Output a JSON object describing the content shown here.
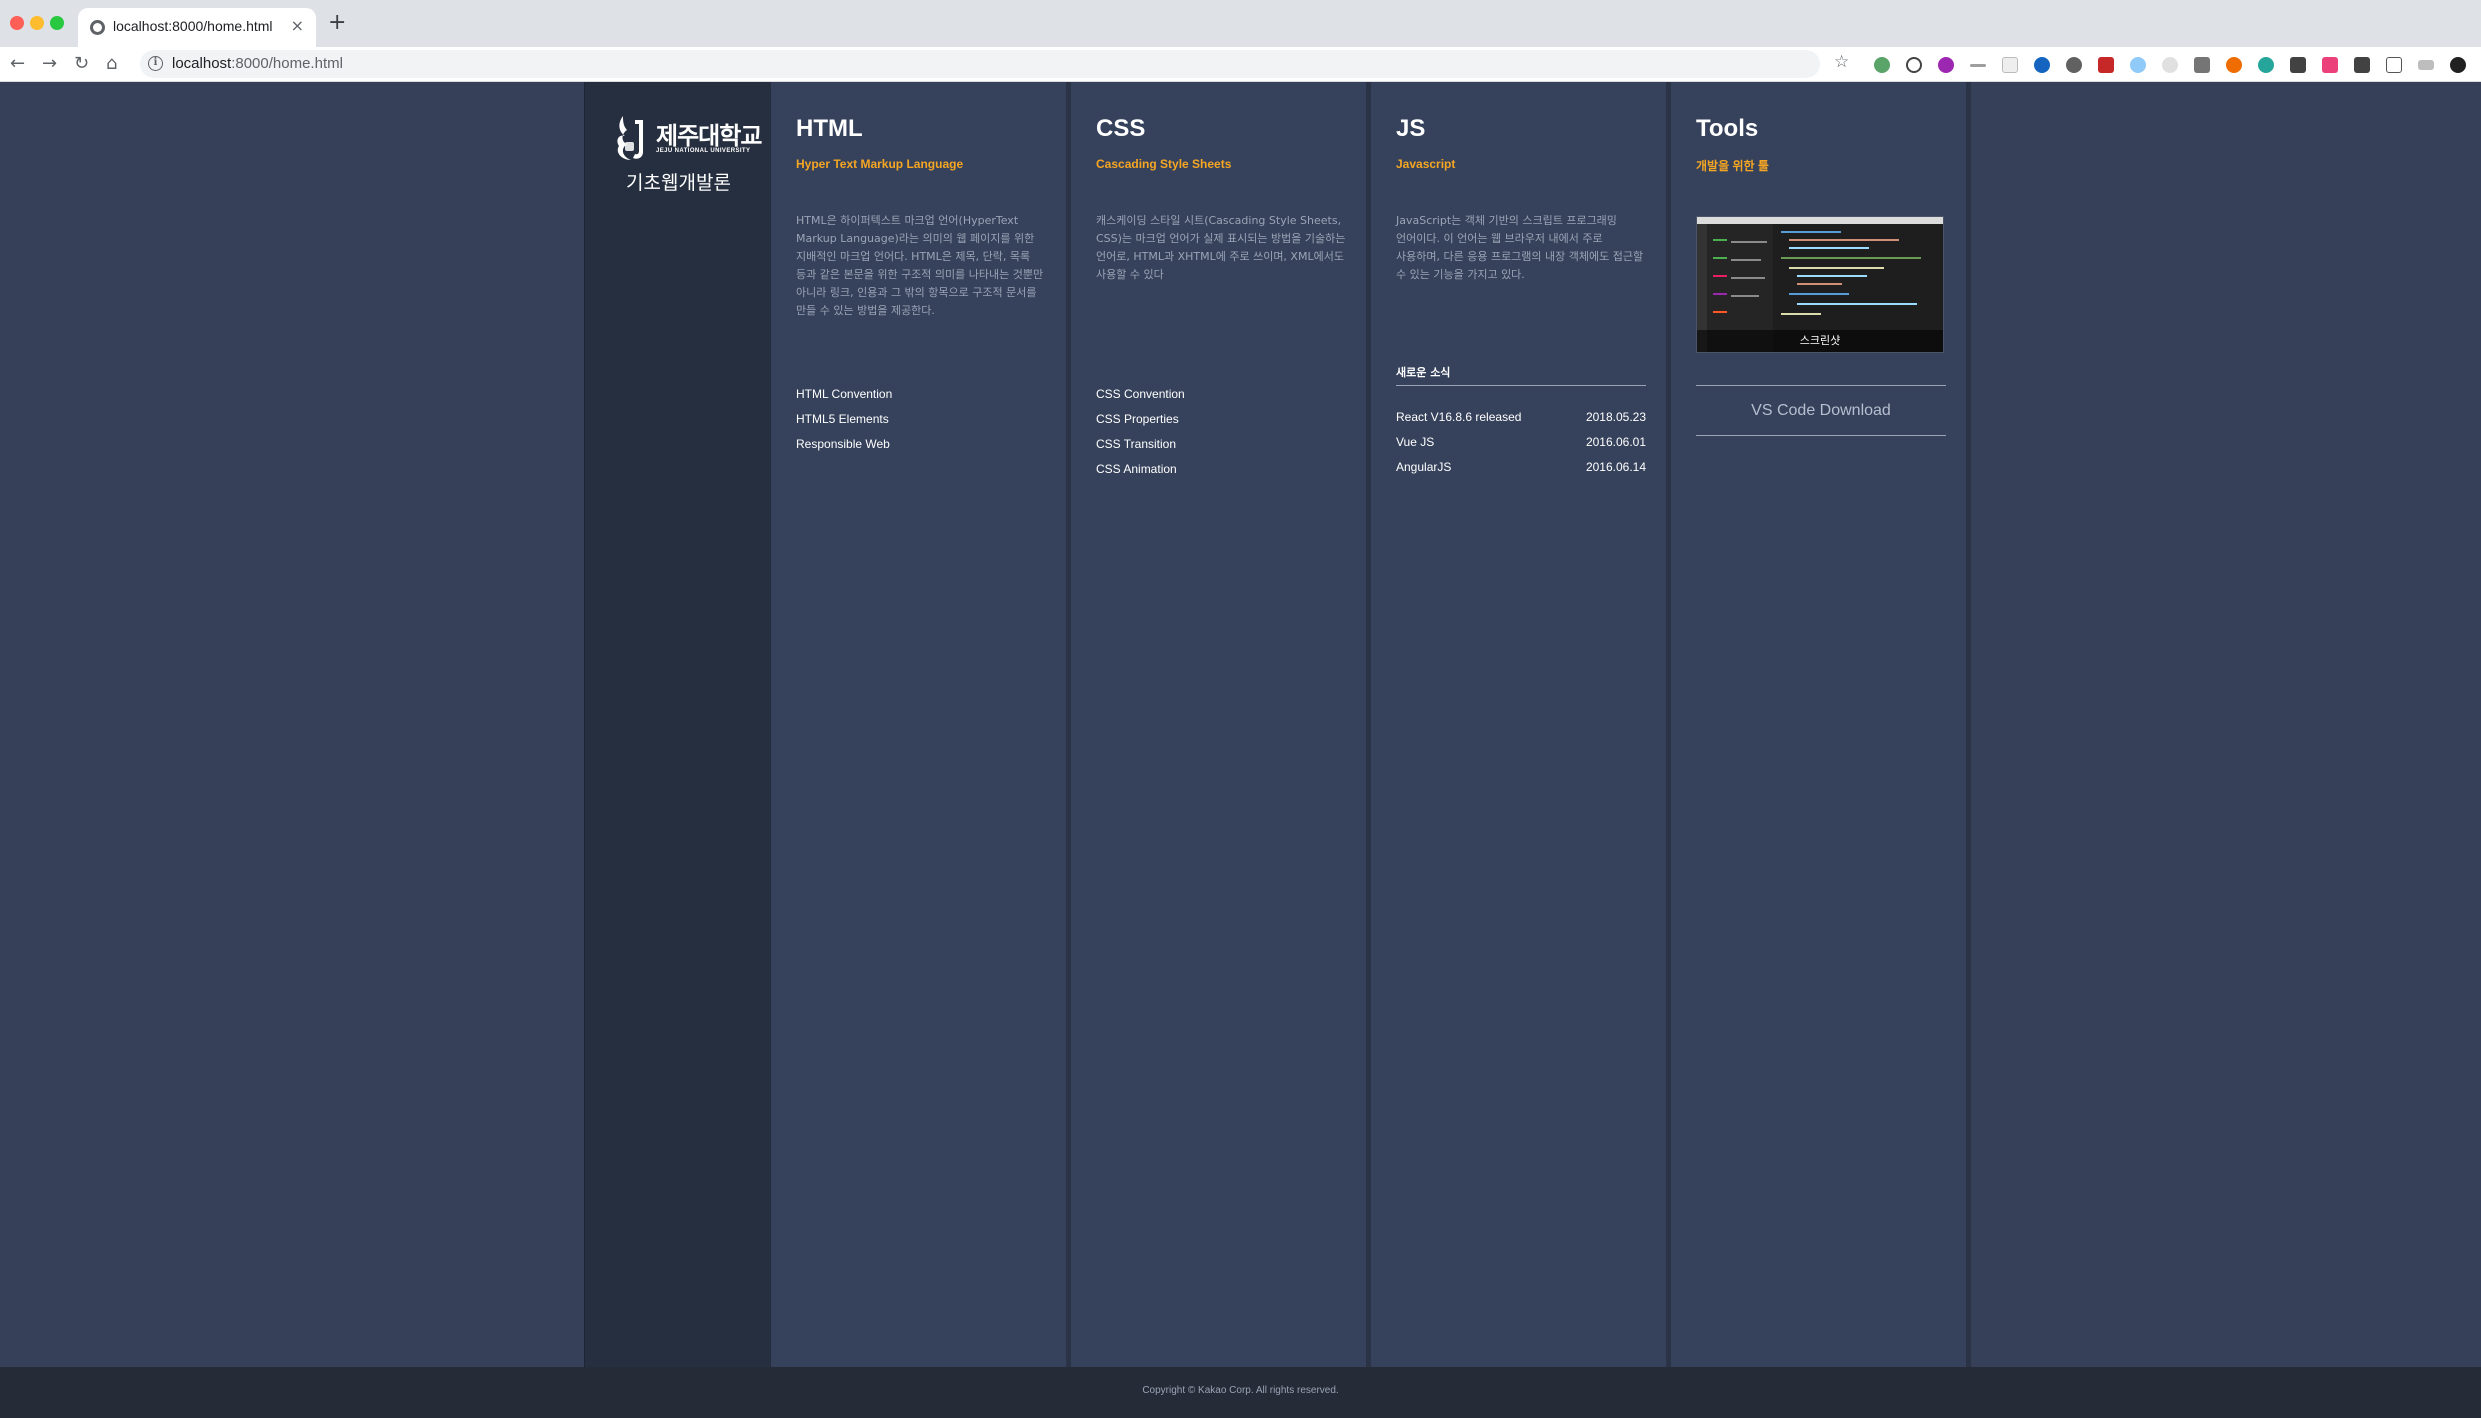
{
  "browser": {
    "tab_title": "localhost:8000/home.html",
    "tab_close": "×",
    "new_tab": "+",
    "url_host": "localhost",
    "url_path": ":8000/home.html",
    "nav": {
      "back": "←",
      "forward": "→",
      "reload": "↻",
      "home": "⌂"
    },
    "star": "☆"
  },
  "brand": {
    "logo_text": "제주대학교",
    "logo_sub": "JEJU NATIONAL UNIVERSITY",
    "title": "기초웹개발론"
  },
  "columns": [
    {
      "title": "HTML",
      "subtitle": "Hyper Text Markup Language",
      "description": "HTML은 하이퍼텍스트 마크업 언어(HyperText Markup Language)라는 의미의 웹 페이지를 위한 지배적인 마크업 언어다. HTML은 제목, 단락, 목록 등과 같은 본문을 위한 구조적 의미를 나타내는 것뿐만 아니라 링크, 인용과 그 밖의 항목으로 구조적 문서를 만들 수 있는 방법을 제공한다.",
      "links": [
        "HTML Convention",
        "HTML5 Elements",
        "Responsible Web"
      ]
    },
    {
      "title": "CSS",
      "subtitle": "Cascading Style Sheets",
      "description": "캐스케이딩 스타일 시트(Cascading Style Sheets, CSS)는 마크업 언어가 실제 표시되는 방법을 기술하는 언어로, HTML과 XHTML에 주로 쓰이며, XML에서도 사용할 수 있다",
      "links": [
        "CSS Convention",
        "CSS Properties",
        "CSS Transition",
        "CSS Animation"
      ]
    },
    {
      "title": "JS",
      "subtitle": "Javascript",
      "description": "JavaScript는 객체 기반의 스크립트 프로그래밍 언어이다. 이 언어는 웹 브라우저 내에서 주로 사용하며, 다른 응용 프로그램의 내장 객체에도 접근할 수 있는 기능을 가지고 있다.",
      "news_title": "새로운 소식",
      "news": [
        {
          "title": "React V16.8.6 released",
          "date": "2018.05.23"
        },
        {
          "title": "Vue JS",
          "date": "2016.06.01"
        },
        {
          "title": "AngularJS",
          "date": "2016.06.14"
        }
      ]
    },
    {
      "title": "Tools",
      "subtitle": "개발을 위한 툴",
      "screenshot_caption": "스크린샷",
      "download_label": "VS Code Download"
    }
  ],
  "footer": {
    "copyright": "Copyright © Kakao Corp. All rights reserved."
  },
  "colors": {
    "page_bg": "#364159",
    "brand_column_bg": "#262f3f",
    "accent_orange": "#f5a623",
    "footer_bg": "#252b37"
  }
}
